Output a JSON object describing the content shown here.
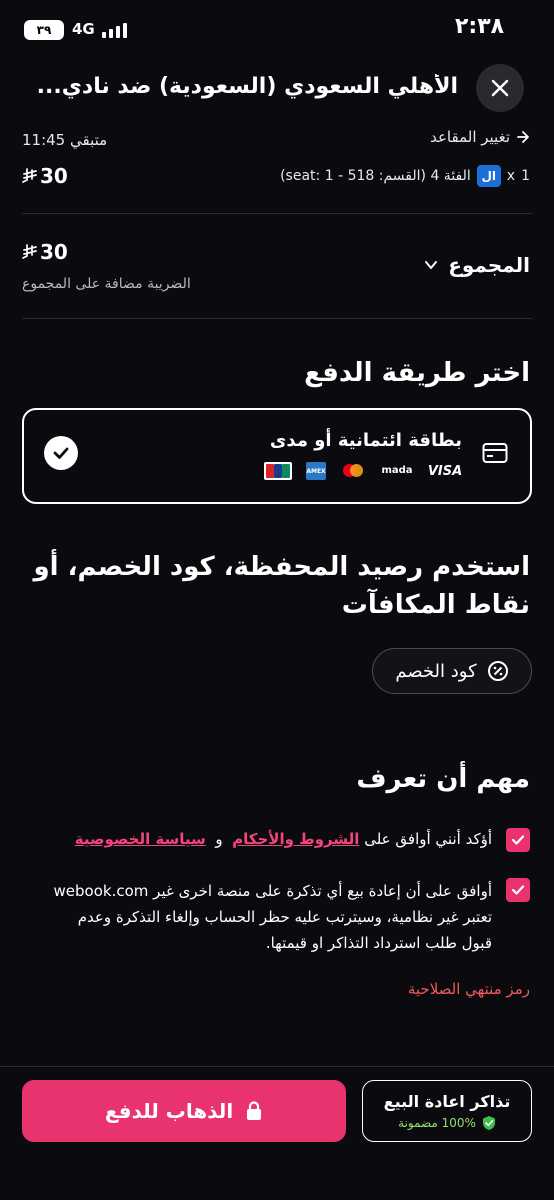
{
  "status_bar": {
    "time": "٢:٣٨",
    "network": "4G",
    "battery": "٣٩"
  },
  "header": {
    "title": "الأهلي السعودي (السعودية) ضد نادي..."
  },
  "ticket": {
    "change_seats": "تغيير المقاعد",
    "remaining": "متبقي 11:45",
    "quantity": "1",
    "times": "x",
    "logo_text": "ال",
    "description": "الفئة 4 (القسم: 518 - 1 :seat)",
    "price": "30",
    "currency": "⃁"
  },
  "total": {
    "label": "المجموع",
    "price": "30",
    "tax_note": "الضريبة مضافة على المجموع"
  },
  "payment": {
    "heading": "اختر طريقة الدفع",
    "card_label": "بطاقة ائتمانية أو مدى",
    "logos": [
      "VISA",
      "mada",
      "mastercard",
      "AMEX",
      "UnionPay"
    ]
  },
  "wallet": {
    "heading": "استخدم رصيد المحفظة، كود الخصم، أو نقاط المكافآت",
    "discount_button": "كود الخصم"
  },
  "info": {
    "heading": "مهم أن تعرف",
    "agree_prefix": "أؤكد أنني أوافق على",
    "terms_link": "الشروط والأحكام",
    "and": "و",
    "privacy_link": "سياسة الخصوصية",
    "resale_agreement": "أوافق على أن إعادة بيع أي تذكرة على منصة اخرى غير webook.com تعتبر غير نظامية، وسيترتب عليه حظر الحساب وإلغاء التذكرة وعدم قبول طلب استرداد التذاكر او قيمتها.",
    "expired_code": "رمز منتهي الصلاحية"
  },
  "footer": {
    "pay_button": "الذهاب للدفع",
    "resale_title": "تذاكر اعادة البيع",
    "resale_guarantee": "100% مضمونة"
  },
  "colors": {
    "accent": "#e8336e",
    "background": "#0b0a0f",
    "error": "#f0585a",
    "guarantee": "#8fe26b"
  }
}
